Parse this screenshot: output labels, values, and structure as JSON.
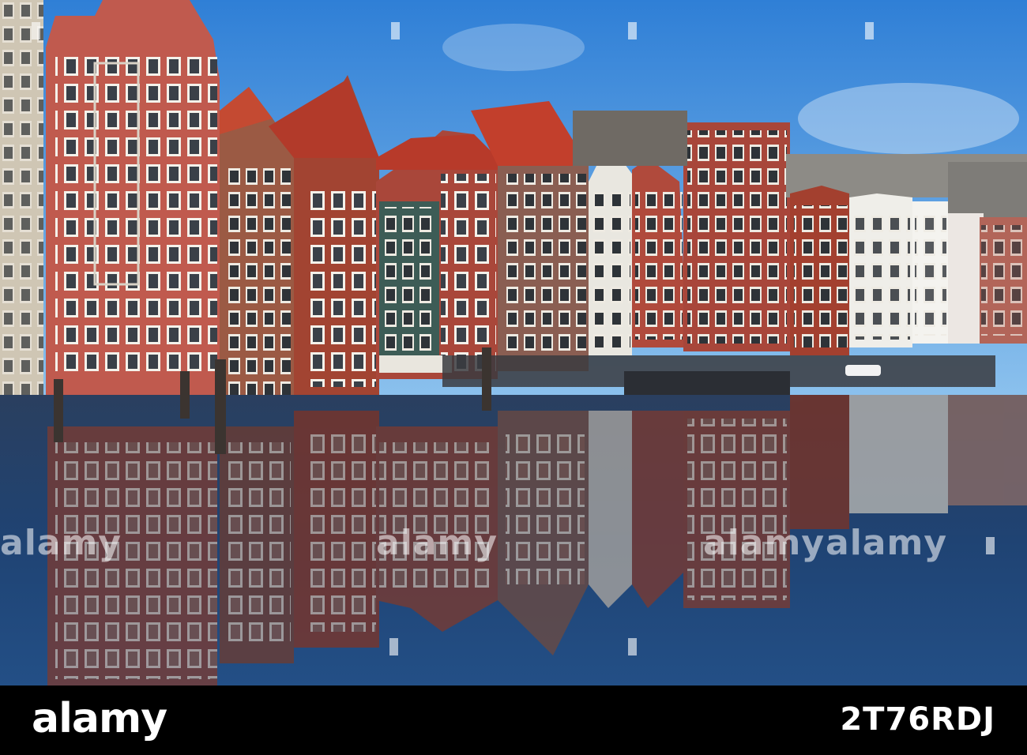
{
  "watermark": {
    "text": "alamy"
  },
  "footer": {
    "logo": "alamy",
    "image_id": "2T76RDJ"
  },
  "colors": {
    "sky": "#3f8fd8",
    "water": "#1c3c6a",
    "brick": "#a8493a",
    "footer_bg": "#000000"
  }
}
